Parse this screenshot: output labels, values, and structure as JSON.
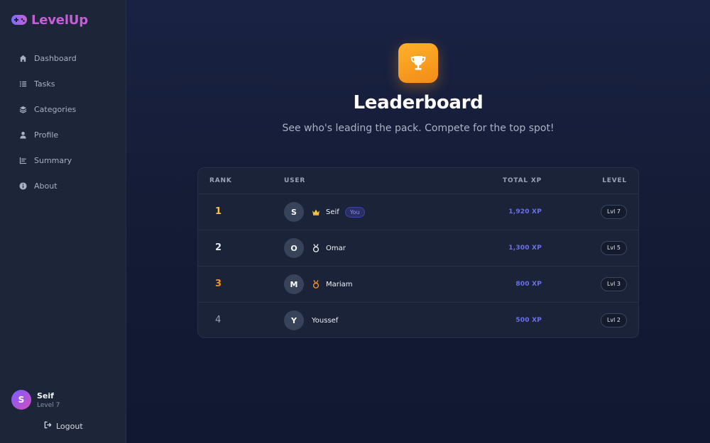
{
  "brand": {
    "name": "LevelUp"
  },
  "nav": [
    {
      "label": "Dashboard",
      "icon": "home-icon"
    },
    {
      "label": "Tasks",
      "icon": "list-icon"
    },
    {
      "label": "Categories",
      "icon": "layers-icon"
    },
    {
      "label": "Profile",
      "icon": "user-icon"
    },
    {
      "label": "Summary",
      "icon": "bar-chart-icon"
    },
    {
      "label": "About",
      "icon": "info-icon"
    }
  ],
  "current_user": {
    "initial": "S",
    "name": "Seif",
    "level": "Level 7"
  },
  "logout_label": "Logout",
  "page": {
    "title": "Leaderboard",
    "subtitle": "See who's leading the pack. Compete for the top spot!"
  },
  "table": {
    "headers": {
      "rank": "RANK",
      "user": "USER",
      "xp": "TOTAL XP",
      "level": "LEVEL"
    },
    "rows": [
      {
        "rank": "1",
        "initial": "S",
        "name": "Seif",
        "medal": "crown-icon",
        "badge": "You",
        "xp": "1,920 XP",
        "level": "Lvl 7"
      },
      {
        "rank": "2",
        "initial": "O",
        "name": "Omar",
        "medal": "silver-medal-icon",
        "badge": "",
        "xp": "1,300 XP",
        "level": "Lvl 5"
      },
      {
        "rank": "3",
        "initial": "M",
        "name": "Mariam",
        "medal": "bronze-medal-icon",
        "badge": "",
        "xp": "800 XP",
        "level": "Lvl 3"
      },
      {
        "rank": "4",
        "initial": "Y",
        "name": "Youssef",
        "medal": "",
        "badge": "",
        "xp": "500 XP",
        "level": "Lvl 2"
      }
    ]
  },
  "colors": {
    "gold": "#f5c542",
    "silver": "#e5e7eb",
    "bronze": "#f0922b",
    "plain": "#9aa3b7",
    "accent": "#6c6ff2"
  }
}
